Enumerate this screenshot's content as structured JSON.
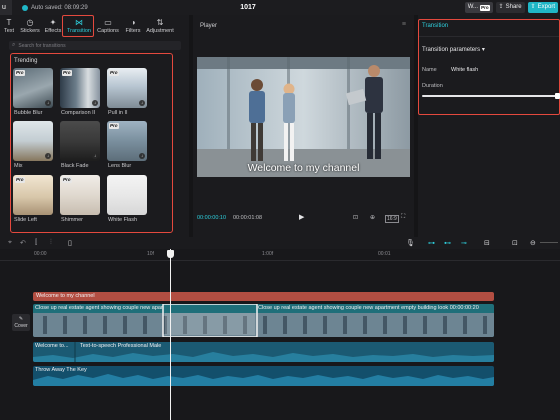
{
  "titlebar": {
    "menu_label": "u",
    "autosave": "Auto saved: 08:09:29",
    "project_name": "1017",
    "workspace": "W...",
    "pro_badge": "Pro",
    "share": "Share",
    "export": "Export"
  },
  "tabs": [
    {
      "label": "Text",
      "icon": "T"
    },
    {
      "label": "Stickers",
      "icon": "◷"
    },
    {
      "label": "Effects",
      "icon": "✦"
    },
    {
      "label": "Transition",
      "icon": "⋈"
    },
    {
      "label": "Captions",
      "icon": "▭"
    },
    {
      "label": "Filters",
      "icon": "◑"
    },
    {
      "label": "Adjustment",
      "icon": "⇅"
    }
  ],
  "active_tab": "Transition",
  "search": {
    "placeholder": "Search for transitions"
  },
  "browse": {
    "section": "Trending",
    "pro_label": "Pro",
    "items": [
      {
        "name": "Bubble Blur",
        "pro": true
      },
      {
        "name": "Comparison II",
        "pro": true
      },
      {
        "name": "Pull in II",
        "pro": true
      },
      {
        "name": "Mix",
        "pro": false
      },
      {
        "name": "Black Fade",
        "pro": false
      },
      {
        "name": "Lens Blur",
        "pro": true
      },
      {
        "name": "Slide Left",
        "pro": true
      },
      {
        "name": "Shimmer",
        "pro": true
      },
      {
        "name": "White Flash",
        "pro": false
      }
    ]
  },
  "player": {
    "title": "Player",
    "caption": "Welcome to my channel",
    "current_time": "00:00:00:10",
    "total_time": "00:00:01:08",
    "ratio_label": "16:9"
  },
  "inspector": {
    "tab": "Transition",
    "section": "Transition parameters",
    "name_label": "Name",
    "name_value": "White flash",
    "duration_label": "Duration",
    "duration_fraction": 1.0
  },
  "timeline": {
    "ruler": [
      "00:00",
      "10f",
      "1:00f",
      "00:01"
    ],
    "cover_label": "Cover",
    "text_clip": "Welcome to my channel",
    "video_clip_a": "Close up real estate agent showing couple new apartment empty buildin",
    "video_clip_b": "Close up real estate agent showing couple new apartment empty building look 00:00:00:20",
    "tts_clip_a": "Welcome to...",
    "tts_clip_b": "Text-to-speech Professional Male",
    "music_clip": "Throw Away The Key"
  },
  "colors": {
    "accent": "#2ed0de",
    "highlight": "#e4493e",
    "text_track": "#b24e42",
    "video_track": "#1f6f7a",
    "audio_track": "#134f6b"
  }
}
